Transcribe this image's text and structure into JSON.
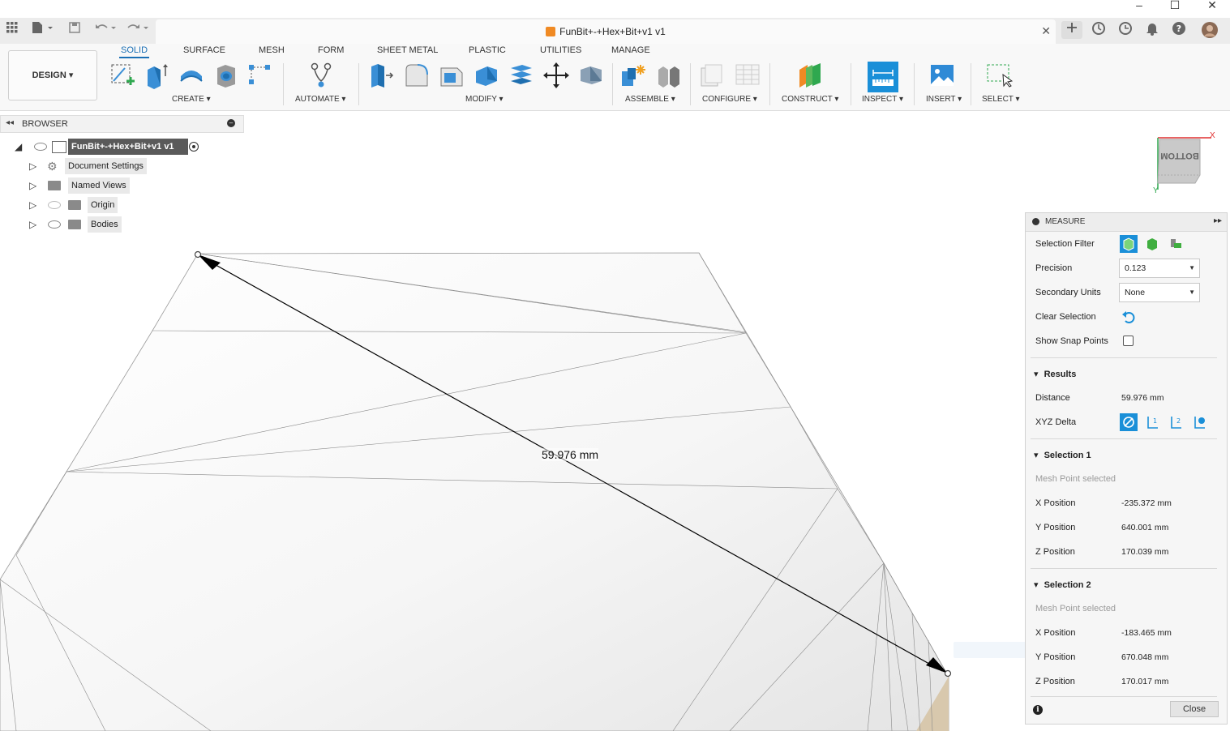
{
  "window": {
    "title": "FunBit+-+Hex+Bit+v1 v1",
    "controls": [
      "–",
      "☐",
      "✕"
    ]
  },
  "ribbon": {
    "workspace": "DESIGN",
    "tabs": [
      "SOLID",
      "SURFACE",
      "MESH",
      "FORM",
      "SHEET METAL",
      "PLASTIC",
      "UTILITIES",
      "MANAGE"
    ],
    "active_tab": "SOLID",
    "groups": [
      "CREATE",
      "AUTOMATE",
      "MODIFY",
      "ASSEMBLE",
      "CONFIGURE",
      "CONSTRUCT",
      "INSPECT",
      "INSERT",
      "SELECT"
    ]
  },
  "browser": {
    "title": "BROWSER",
    "root": "FunBit+-+Hex+Bit+v1 v1",
    "items": [
      "Document Settings",
      "Named Views",
      "Origin",
      "Bodies"
    ]
  },
  "viewcube": {
    "face": "BOTTOM",
    "axis_x": "X",
    "axis_y": "Y"
  },
  "canvas": {
    "dimension_label": "59.976 mm"
  },
  "measure": {
    "title": "MEASURE",
    "selection_filter_label": "Selection Filter",
    "precision_label": "Precision",
    "precision_value": "0.123",
    "secondary_units_label": "Secondary Units",
    "secondary_units_value": "None",
    "clear_selection_label": "Clear Selection",
    "show_snap_points_label": "Show Snap Points",
    "results": {
      "header": "Results",
      "distance_label": "Distance",
      "distance_value": "59.976 mm",
      "xyz_delta_label": "XYZ Delta"
    },
    "selection1": {
      "header": "Selection 1",
      "status": "Mesh Point selected",
      "x_label": "X Position",
      "x": "-235.372 mm",
      "y_label": "Y Position",
      "y": "640.001 mm",
      "z_label": "Z Position",
      "z": "170.039 mm"
    },
    "selection2": {
      "header": "Selection 2",
      "status": "Mesh Point selected",
      "x_label": "X Position",
      "x": "-183.465 mm",
      "y_label": "Y Position",
      "y": "670.048 mm",
      "z_label": "Z Position",
      "z": "170.017 mm"
    },
    "close_label": "Close"
  },
  "colors": {
    "accent": "#1a6fb5",
    "tool_blue": "#3a8fd6",
    "inspect_active": "#1a8fd8"
  }
}
